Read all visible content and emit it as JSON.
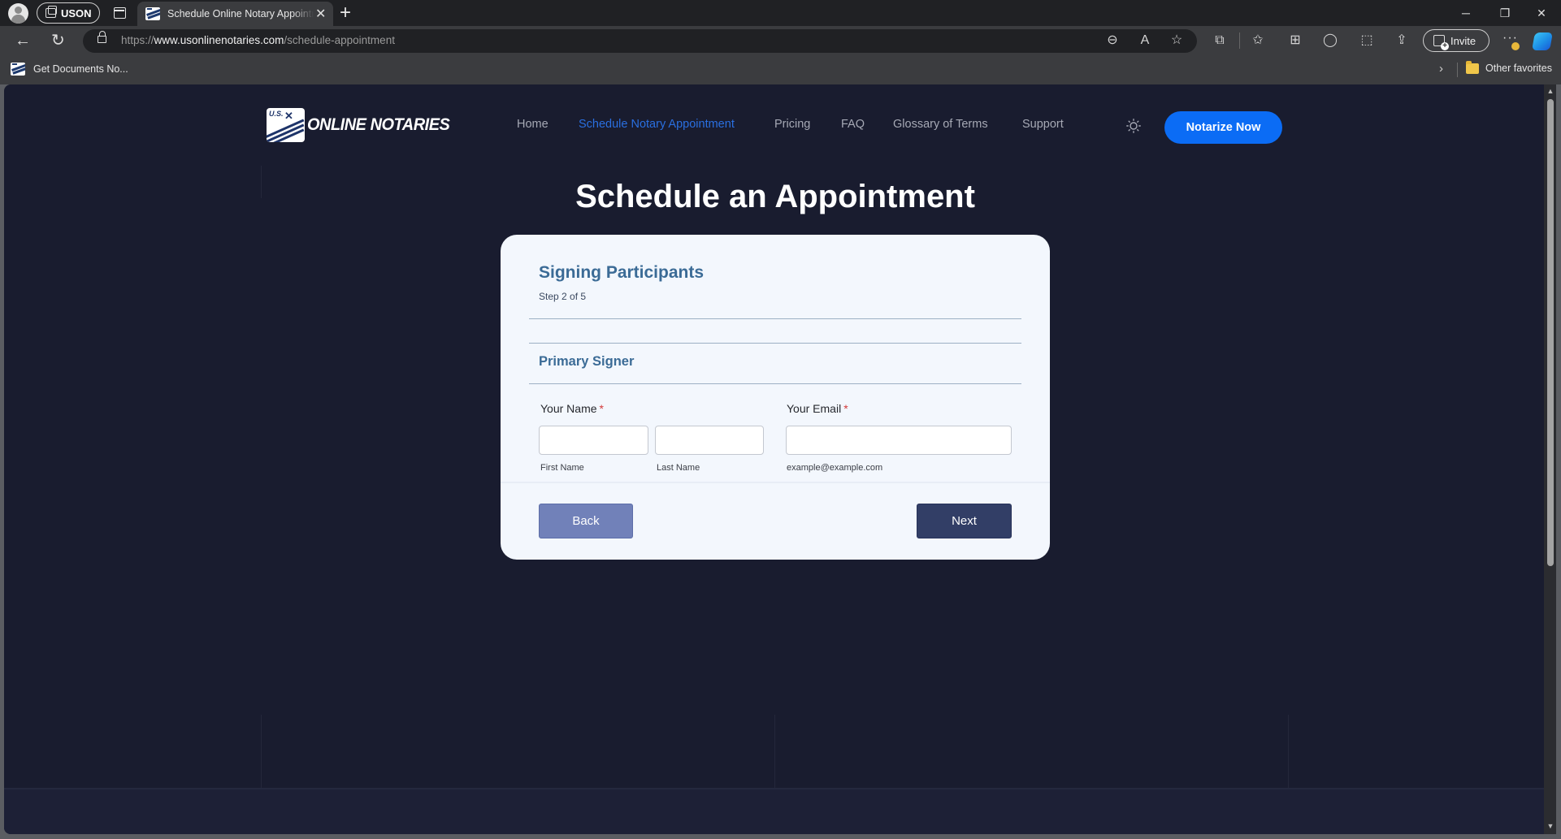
{
  "browser": {
    "workspace_label": "USON",
    "tab": {
      "title": "Schedule Online Notary Appointment"
    },
    "url": {
      "scheme": "https://",
      "host": "www.usonlinenotaries.com",
      "path": "/schedule-appointment"
    },
    "toolbar_icons": [
      "zoom-out-icon",
      "read-aloud-icon",
      "favorite-star-icon",
      "extensions-icon",
      "favorites-icon",
      "collections-icon",
      "chat-icon",
      "screenshot-icon",
      "share-icon",
      "more-icon",
      "copilot-icon"
    ],
    "invite_label": "Invite",
    "bookmarks": [
      {
        "label": "Get Documents No..."
      }
    ],
    "other_favorites_label": "Other favorites",
    "window_controls": {
      "minimize": "─",
      "restore": "❐",
      "close": "✕"
    },
    "glyphs": {
      "back": "←",
      "reload": "↻",
      "new_tab": "+",
      "tab_close": "✕",
      "chevron": "›",
      "more": "···",
      "zoom_out": "⊖",
      "read_aloud": "A",
      "star": "☆",
      "extensions": "⧉",
      "favorites": "✩",
      "collections": "⊞",
      "chat": "◯",
      "screenshot": "⬚",
      "share": "⇪",
      "scroll_up": "▲",
      "scroll_down": "▼"
    }
  },
  "site": {
    "logo": {
      "mark_text": "U.S.",
      "text": "ONLINE NOTARIES"
    },
    "nav": [
      {
        "label": "Home",
        "active": false
      },
      {
        "label": "Schedule Notary Appointment",
        "active": true
      },
      {
        "label": "Pricing",
        "active": false
      },
      {
        "label": "FAQ",
        "active": false
      },
      {
        "label": "Glossary of Terms",
        "active": false
      },
      {
        "label": "Support",
        "active": false
      }
    ],
    "theme_toggle_icon": "sun-icon",
    "cta_label": "Notarize Now",
    "accent_color": "#0b6cf5"
  },
  "page": {
    "title": "Schedule an Appointment",
    "form": {
      "step_title": "Signing Participants",
      "step_text": "Step 2 of 5",
      "section_title": "Primary Signer",
      "name_label": "Your Name",
      "email_label": "Your Email",
      "required_marker": "*",
      "first_name": {
        "value": "",
        "sublabel": "First Name"
      },
      "last_name": {
        "value": "",
        "sublabel": "Last Name"
      },
      "email": {
        "value": "",
        "sublabel": "example@example.com"
      },
      "back_label": "Back",
      "next_label": "Next"
    }
  }
}
